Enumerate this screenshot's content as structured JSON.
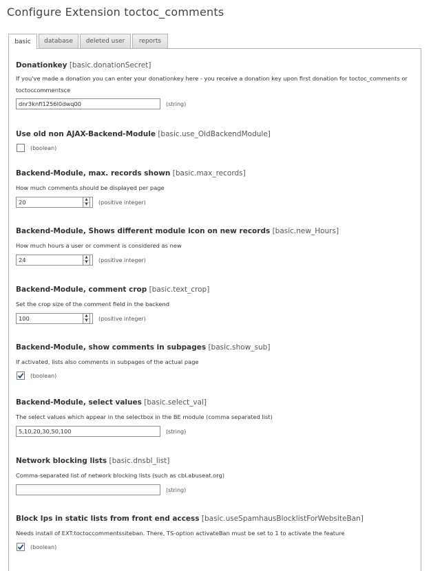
{
  "page_title": "Configure Extension toctoc_comments",
  "tabs": [
    {
      "label": "basic",
      "active": true
    },
    {
      "label": "database",
      "active": false
    },
    {
      "label": "deleted user",
      "active": false
    },
    {
      "label": "reports",
      "active": false
    }
  ],
  "fields": {
    "donation": {
      "label": "Donationkey",
      "key": "[basic.donationSecret]",
      "desc": "If you've made a donation you can enter your donationkey here - you receive a donation key upon first donation for toctoc_comments or toctoccommentsce",
      "value": "dnr3knfi1256l0dwq00",
      "type": "(string)"
    },
    "old_backend": {
      "label": "Use old non AJAX-Backend-Module",
      "key": "[basic.use_OldBackendModule]",
      "checked": false,
      "type": "(boolean)"
    },
    "max_records": {
      "label": "Backend-Module, max. records shown",
      "key": "[basic.max_records]",
      "desc": "How much comments should be displayed per page",
      "value": "20",
      "type": "(positive integer)"
    },
    "new_hours": {
      "label": "Backend-Module, Shows different module icon on new records",
      "key": "[basic.new_Hours]",
      "desc": "How much hours a user or comment is considered as new",
      "value": "24",
      "type": "(positive integer)"
    },
    "text_crop": {
      "label": "Backend-Module, comment crop",
      "key": "[basic.text_crop]",
      "desc": "Set the crop size of the comment field in the backend",
      "value": "100",
      "type": "(positive integer)"
    },
    "show_sub": {
      "label": "Backend-Module, show comments in subpages",
      "key": "[basic.show_sub]",
      "desc": "If activated, lists also comments in subpages of the actual page",
      "checked": true,
      "type": "(boolean)"
    },
    "select_val": {
      "label": "Backend-Module, select values",
      "key": "[basic.select_val]",
      "desc": "The select values which appear in the selectbox in the BE module (comma separated list)",
      "value": "5,10,20,30,50,100",
      "type": "(string)"
    },
    "dnsbl": {
      "label": "Network blocking lists",
      "key": "[basic.dnsbl_list]",
      "desc": "Comma-separated list of network blocking lists (such as cbl.abuseat.org)",
      "value": "",
      "type": "(string)"
    },
    "spamhaus": {
      "label": "Block Ips in static lists from front end access",
      "key": "[basic.useSpamhausBlocklistForWebsiteBan]",
      "desc": "Needs install of EXT:toctoccommentssiteban. There, TS-option activateBan must be set to 1 to activate the feature",
      "checked": true,
      "type": "(boolean)"
    }
  }
}
